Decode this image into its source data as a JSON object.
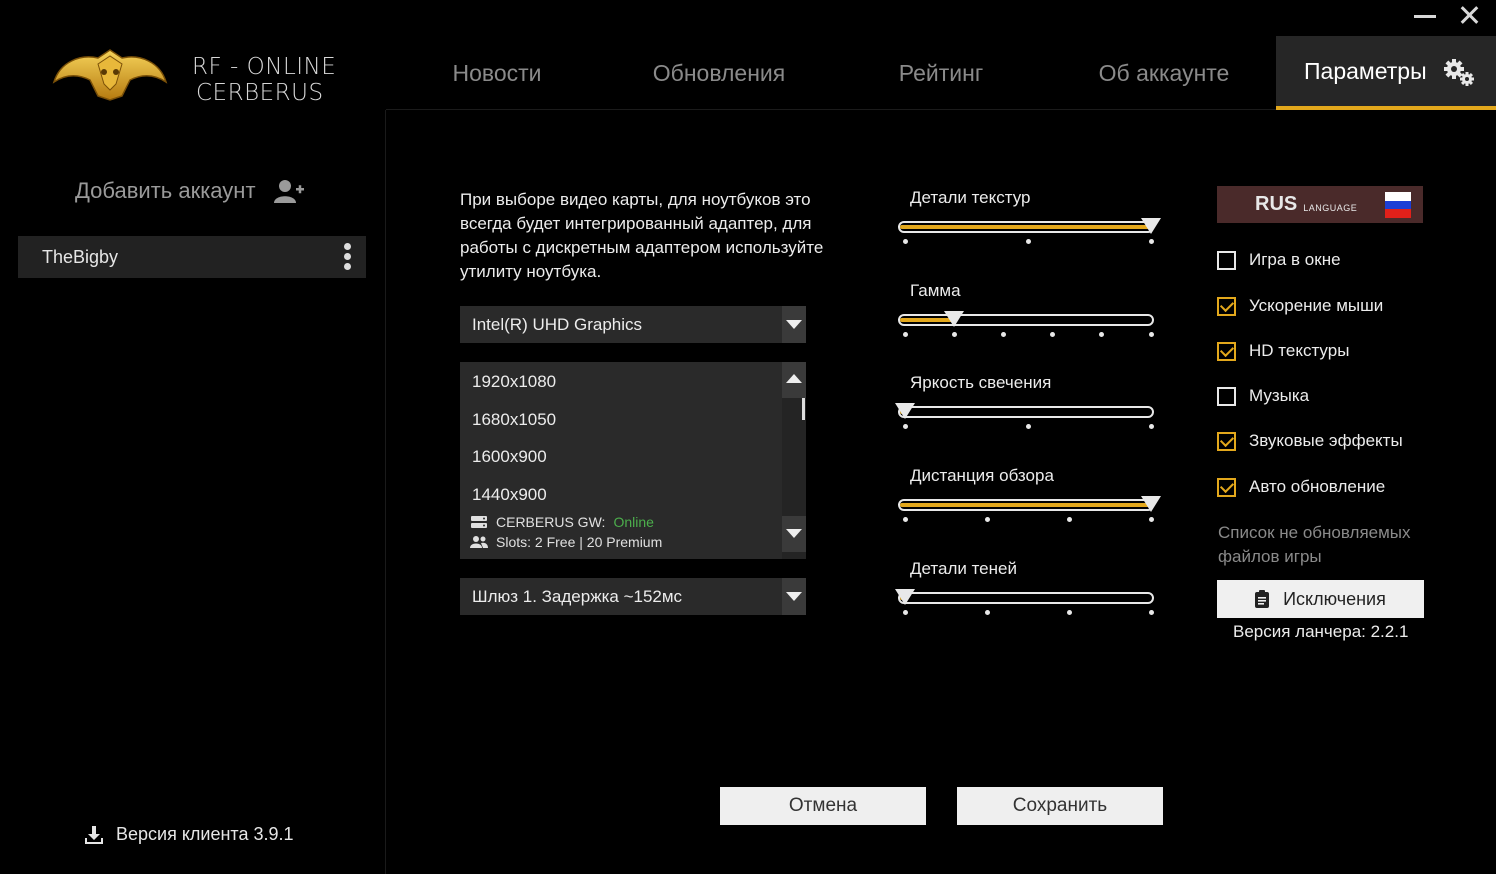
{
  "window": {
    "minimize_icon": "minimize-icon",
    "close_icon": "close-icon"
  },
  "brand": {
    "line1": "RF - ONLINE",
    "line2": "CERBERUS",
    "accent": "#e3a81c"
  },
  "tabs": [
    {
      "label": "Новости"
    },
    {
      "label": "Обновления"
    },
    {
      "label": "Рейтинг"
    },
    {
      "label": "Об аккаунте"
    },
    {
      "label": "Параметры",
      "active": true
    }
  ],
  "sidebar": {
    "add_account_label": "Добавить аккаунт",
    "accounts": [
      {
        "name": "TheBigby"
      }
    ],
    "client_version": "Версия клиента 3.9.1"
  },
  "graphics": {
    "note": "При выборе видео карты, для ноутбуков это всегда будет интегрированный адаптер, для работы с дискретным адаптером используйте утилиту ноутбука.",
    "gpu_selected": "Intel(R) UHD Graphics",
    "resolutions": [
      "1920x1080",
      "1680x1050",
      "1600x900",
      "1440x900"
    ],
    "gateway_label": "CERBERUS GW:",
    "gateway_status": "Online",
    "slots": "Slots: 2 Free | 20 Premium",
    "gateway_selected": "Шлюз 1. Задержка ~152мс"
  },
  "sliders": [
    {
      "label": "Детали текстур",
      "level": 1.0,
      "ticks": 3
    },
    {
      "label": "Гамма",
      "level": 0.2,
      "ticks": 6
    },
    {
      "label": "Яркость свечения",
      "level": 0.0,
      "ticks": 3
    },
    {
      "label": "Дистанция обзора",
      "level": 1.0,
      "ticks": 4
    },
    {
      "label": "Детали теней",
      "level": 0.0,
      "ticks": 4
    }
  ],
  "language": {
    "code": "RUS",
    "word": "LANGUAGE"
  },
  "options": [
    {
      "label": "Игра в окне",
      "checked": false
    },
    {
      "label": "Ускорение мыши",
      "checked": true
    },
    {
      "label": "HD текстуры",
      "checked": true
    },
    {
      "label": "Музыка",
      "checked": false
    },
    {
      "label": "Звуковые эффекты",
      "checked": true
    },
    {
      "label": "Авто обновление",
      "checked": true
    }
  ],
  "exclusions": {
    "note": "Список не обновляемых файлов игры",
    "button_label": "Исключения",
    "launcher_version": "Версия ланчера: 2.2.1"
  },
  "footer": {
    "cancel_label": "Отмена",
    "save_label": "Сохранить"
  }
}
